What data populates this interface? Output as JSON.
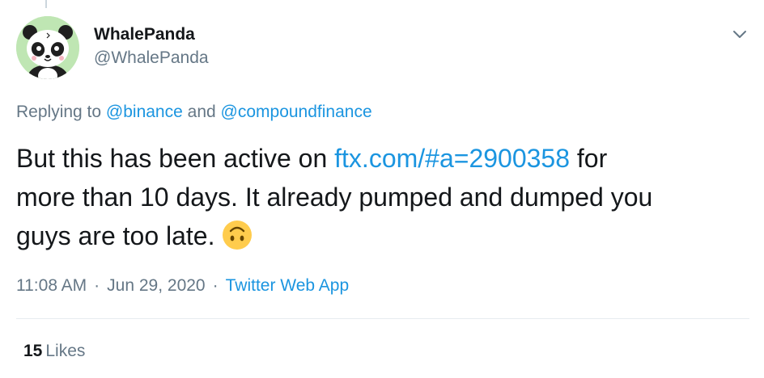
{
  "tweet": {
    "display_name": "WhalePanda",
    "handle": "@WhalePanda",
    "replying_prefix": "Replying to",
    "replying_to_1": "@binance",
    "replying_and": "and",
    "replying_to_2": "@compoundfinance",
    "text_line1_start": "But this has been active on",
    "text_link": "ftx.com/#a=2900358",
    "text_line1_end": "for",
    "text_line2": "more than 10 days. It already pumped and dumped you",
    "text_line3": "guys are too late.",
    "emoji": "upside-down-face-emoji",
    "time": "11:08 AM",
    "separator": "·",
    "date": "Jun 29, 2020",
    "source": "Twitter Web App",
    "likes_count": "15",
    "likes_label": "Likes"
  },
  "colors": {
    "link": "#1b95e0",
    "secondary": "#657786",
    "primary": "#14171a",
    "avatar_bg": "#bfe6b3",
    "emoji": "#ffcc4d"
  },
  "icons": {
    "menu": "chevron-down-icon",
    "avatar": "panda-avatar"
  }
}
